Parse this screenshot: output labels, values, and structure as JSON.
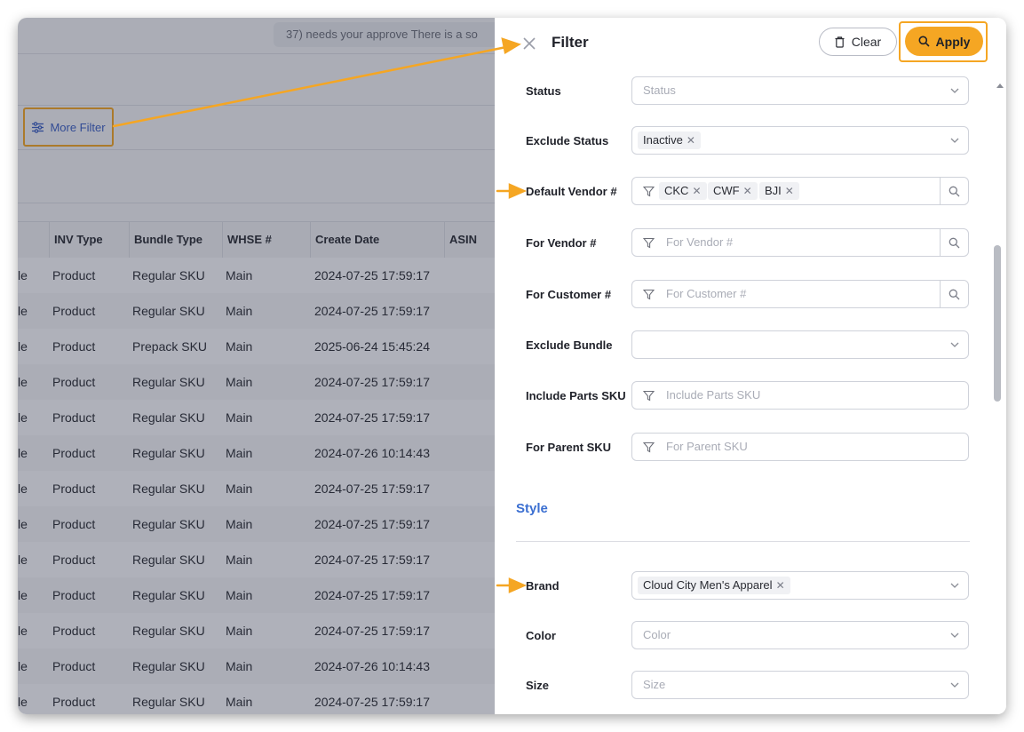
{
  "background": {
    "notice_text": "37) needs your approve   There is a so",
    "more_filter_label": "More Filter",
    "table": {
      "columns": [
        "INV Type",
        "Bundle Type",
        "WHSE #",
        "Create Date",
        "ASIN"
      ],
      "rows": [
        {
          "lead": "le",
          "inv_type": "Product",
          "bundle_type": "Regular SKU",
          "whse": "Main",
          "create_date": "2024-07-25 17:59:17"
        },
        {
          "lead": "le",
          "inv_type": "Product",
          "bundle_type": "Regular SKU",
          "whse": "Main",
          "create_date": "2024-07-25 17:59:17"
        },
        {
          "lead": "le",
          "inv_type": "Product",
          "bundle_type": "Prepack SKU",
          "whse": "Main",
          "create_date": "2025-06-24 15:45:24"
        },
        {
          "lead": "le",
          "inv_type": "Product",
          "bundle_type": "Regular SKU",
          "whse": "Main",
          "create_date": "2024-07-25 17:59:17"
        },
        {
          "lead": "le",
          "inv_type": "Product",
          "bundle_type": "Regular SKU",
          "whse": "Main",
          "create_date": "2024-07-25 17:59:17"
        },
        {
          "lead": "le",
          "inv_type": "Product",
          "bundle_type": "Regular SKU",
          "whse": "Main",
          "create_date": "2024-07-26 10:14:43"
        },
        {
          "lead": "le",
          "inv_type": "Product",
          "bundle_type": "Regular SKU",
          "whse": "Main",
          "create_date": "2024-07-25 17:59:17"
        },
        {
          "lead": "le",
          "inv_type": "Product",
          "bundle_type": "Regular SKU",
          "whse": "Main",
          "create_date": "2024-07-25 17:59:17"
        },
        {
          "lead": "le",
          "inv_type": "Product",
          "bundle_type": "Regular SKU",
          "whse": "Main",
          "create_date": "2024-07-25 17:59:17"
        },
        {
          "lead": "le",
          "inv_type": "Product",
          "bundle_type": "Regular SKU",
          "whse": "Main",
          "create_date": "2024-07-25 17:59:17"
        },
        {
          "lead": "le",
          "inv_type": "Product",
          "bundle_type": "Regular SKU",
          "whse": "Main",
          "create_date": "2024-07-25 17:59:17"
        },
        {
          "lead": "le",
          "inv_type": "Product",
          "bundle_type": "Regular SKU",
          "whse": "Main",
          "create_date": "2024-07-26 10:14:43"
        },
        {
          "lead": "le",
          "inv_type": "Product",
          "bundle_type": "Regular SKU",
          "whse": "Main",
          "create_date": "2024-07-25 17:59:17"
        }
      ]
    }
  },
  "panel": {
    "title": "Filter",
    "clear_label": "Clear",
    "apply_label": "Apply",
    "style_section": "Style",
    "fields": {
      "status": {
        "label": "Status",
        "placeholder": "Status"
      },
      "exclude_status": {
        "label": "Exclude Status",
        "tags": [
          "Inactive"
        ]
      },
      "default_vendor": {
        "label": "Default Vendor #",
        "tags": [
          "CKC",
          "CWF",
          "BJI"
        ]
      },
      "for_vendor": {
        "label": "For Vendor #",
        "placeholder": "For Vendor #"
      },
      "for_customer": {
        "label": "For Customer #",
        "placeholder": "For Customer #"
      },
      "exclude_bundle": {
        "label": "Exclude Bundle"
      },
      "include_parts": {
        "label": "Include Parts SKU",
        "placeholder": "Include Parts SKU"
      },
      "for_parent": {
        "label": "For Parent SKU",
        "placeholder": "For Parent SKU"
      },
      "brand": {
        "label": "Brand",
        "tags": [
          "Cloud City Men's Apparel"
        ]
      },
      "color": {
        "label": "Color",
        "placeholder": "Color"
      },
      "size": {
        "label": "Size",
        "placeholder": "Size"
      }
    }
  },
  "colors": {
    "accent": "#f5a623",
    "link": "#3b6fd1"
  },
  "icons": [
    "close-icon",
    "trash-icon",
    "search-icon",
    "filter-icon",
    "chevron-down-icon",
    "sliders-icon"
  ]
}
